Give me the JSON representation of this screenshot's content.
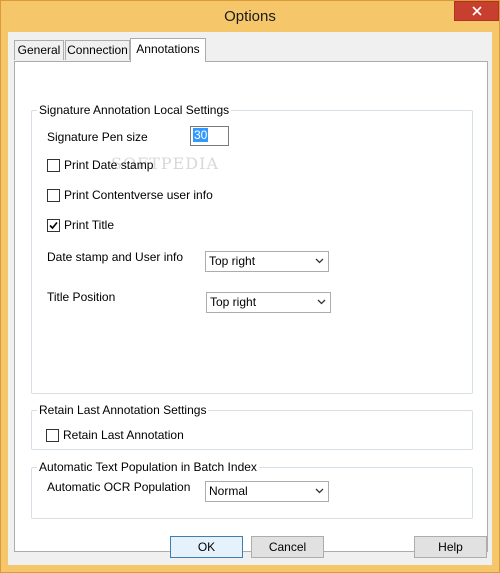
{
  "window": {
    "title": "Options"
  },
  "tabs": [
    {
      "label": "General",
      "active": false
    },
    {
      "label": "Connection",
      "active": false
    },
    {
      "label": "Annotations",
      "active": true
    }
  ],
  "signature_group": {
    "title": "Signature Annotation Local  Settings",
    "pen_size_label": "Signature Pen size",
    "pen_size_value": "30",
    "print_date_stamp": {
      "label": "Print Date stamp",
      "checked": false
    },
    "print_user_info": {
      "label": "Print Contentverse user info",
      "checked": false
    },
    "print_title": {
      "label": "Print Title",
      "checked": true
    },
    "date_stamp_label": "Date stamp and User info",
    "date_stamp_value": "Top right",
    "title_position_label": "Title Position",
    "title_position_value": "Top right"
  },
  "retain_group": {
    "title": "Retain Last Annotation Settings",
    "retain_checkbox": {
      "label": "Retain Last Annotation",
      "checked": false
    }
  },
  "auto_text_group": {
    "title": "Automatic Text Population in Batch Index",
    "ocr_label": "Automatic OCR Population",
    "ocr_value": "Normal"
  },
  "buttons": {
    "ok": "OK",
    "cancel": "Cancel",
    "help": "Help"
  },
  "watermark": "SOFTPEDIA",
  "colors": {
    "title_bar": "#f5c76a",
    "close_button": "#c7402f",
    "selection": "#3399ff"
  }
}
